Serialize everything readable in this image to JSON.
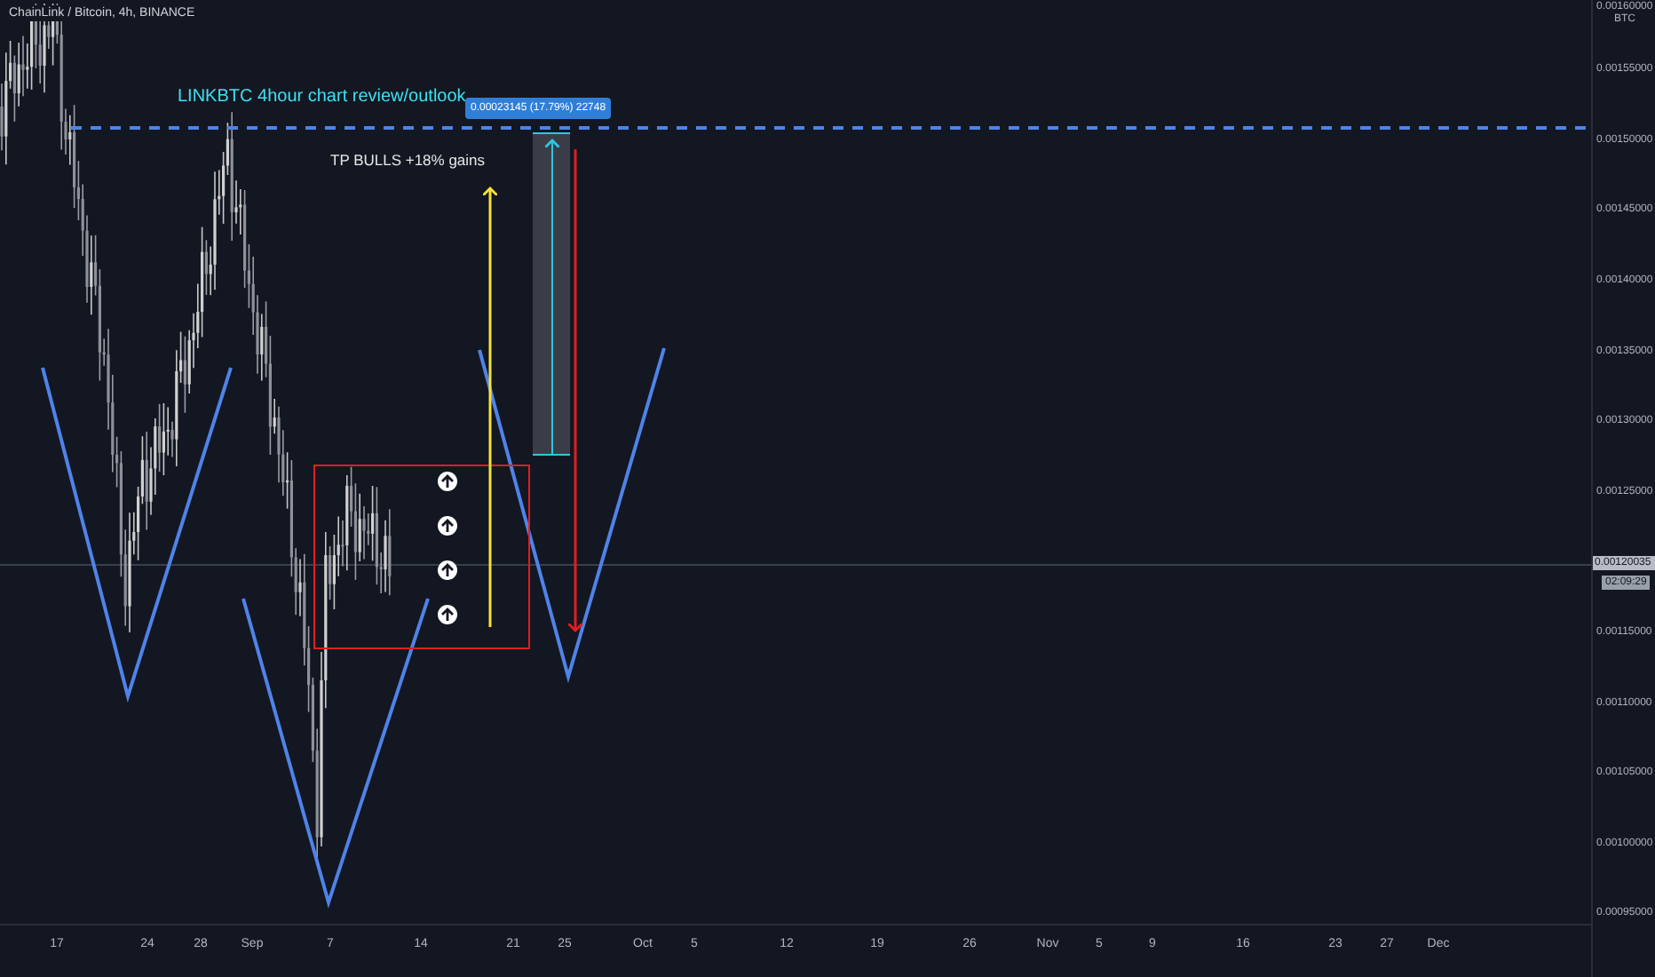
{
  "chart": {
    "symbol": "ChainLink / Bitcoin, 4h, BINANCE",
    "headline": "LINKBTC 4hour chart review/outlook",
    "target_note": "TP BULLS +18% gains",
    "measure_label": "0.00023145 (17.79%) 22748"
  },
  "price_axis": {
    "labels": [
      "0.00160000",
      "0.00155000",
      "0.00150000",
      "0.00145000",
      "0.00140000",
      "0.00135000",
      "0.00130000",
      "0.00125000",
      "0.00115000",
      "0.00110000",
      "0.00105000",
      "0.00100000",
      "0.00095000"
    ],
    "unit": "BTC",
    "last_price": "0.00120035",
    "countdown": "02:09:29"
  },
  "time_axis": {
    "labels": [
      "17",
      "24",
      "28",
      "Sep",
      "7",
      "14",
      "21",
      "25",
      "Oct",
      "5",
      "12",
      "19",
      "26",
      "Nov",
      "5",
      "9",
      "16",
      "23",
      "27",
      "Dec"
    ]
  }
}
